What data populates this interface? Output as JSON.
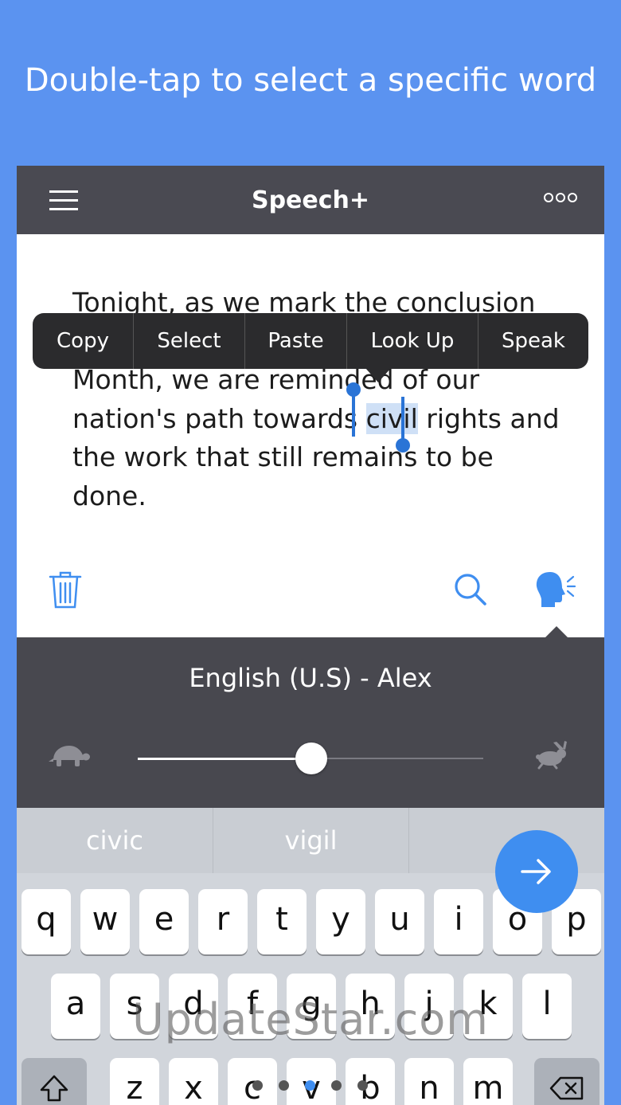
{
  "banner": {
    "caption": "Double-tap to select a specific word"
  },
  "navbar": {
    "title": "Speech+",
    "menu_icon": "hamburger-menu-icon",
    "more_icon": "more-options-icon"
  },
  "document": {
    "lines": [
      "Tonight, as we mark the conclusion",
      "Month, we are reminded of our",
      "nation's path towards ",
      "the work that still remains to be",
      "done."
    ],
    "selected_word": "civil",
    "after_selection": " rights and"
  },
  "context_menu": {
    "items": [
      "Copy",
      "Select",
      "Paste",
      "Look Up",
      "Speak"
    ]
  },
  "toolbar": {
    "trash_icon": "trash-icon",
    "search_icon": "search-icon",
    "speak_icon": "speaking-head-icon"
  },
  "voice_panel": {
    "voice": "English (U.S) - Alex",
    "slow_icon": "turtle-icon",
    "fast_icon": "rabbit-icon",
    "speed_fraction": 0.5
  },
  "keyboard": {
    "suggestions": [
      "civic",
      "vigil",
      ""
    ],
    "row1": [
      "q",
      "w",
      "e",
      "r",
      "t",
      "y",
      "u",
      "i",
      "o",
      "p"
    ],
    "row2": [
      "a",
      "s",
      "d",
      "f",
      "g",
      "h",
      "j",
      "k",
      "l"
    ],
    "row3": [
      "z",
      "x",
      "c",
      "v",
      "b",
      "n",
      "m"
    ],
    "shift_icon": "shift-icon",
    "backspace_icon": "backspace-icon",
    "go_icon": "arrow-right-icon"
  },
  "watermark": "UpdateStar.com",
  "page_indicator": {
    "count": 5,
    "active": 2
  },
  "colors": {
    "background": "#5b93f0",
    "navbar": "#4a4a52",
    "accent": "#2a74d6",
    "panel": "#48484f"
  }
}
